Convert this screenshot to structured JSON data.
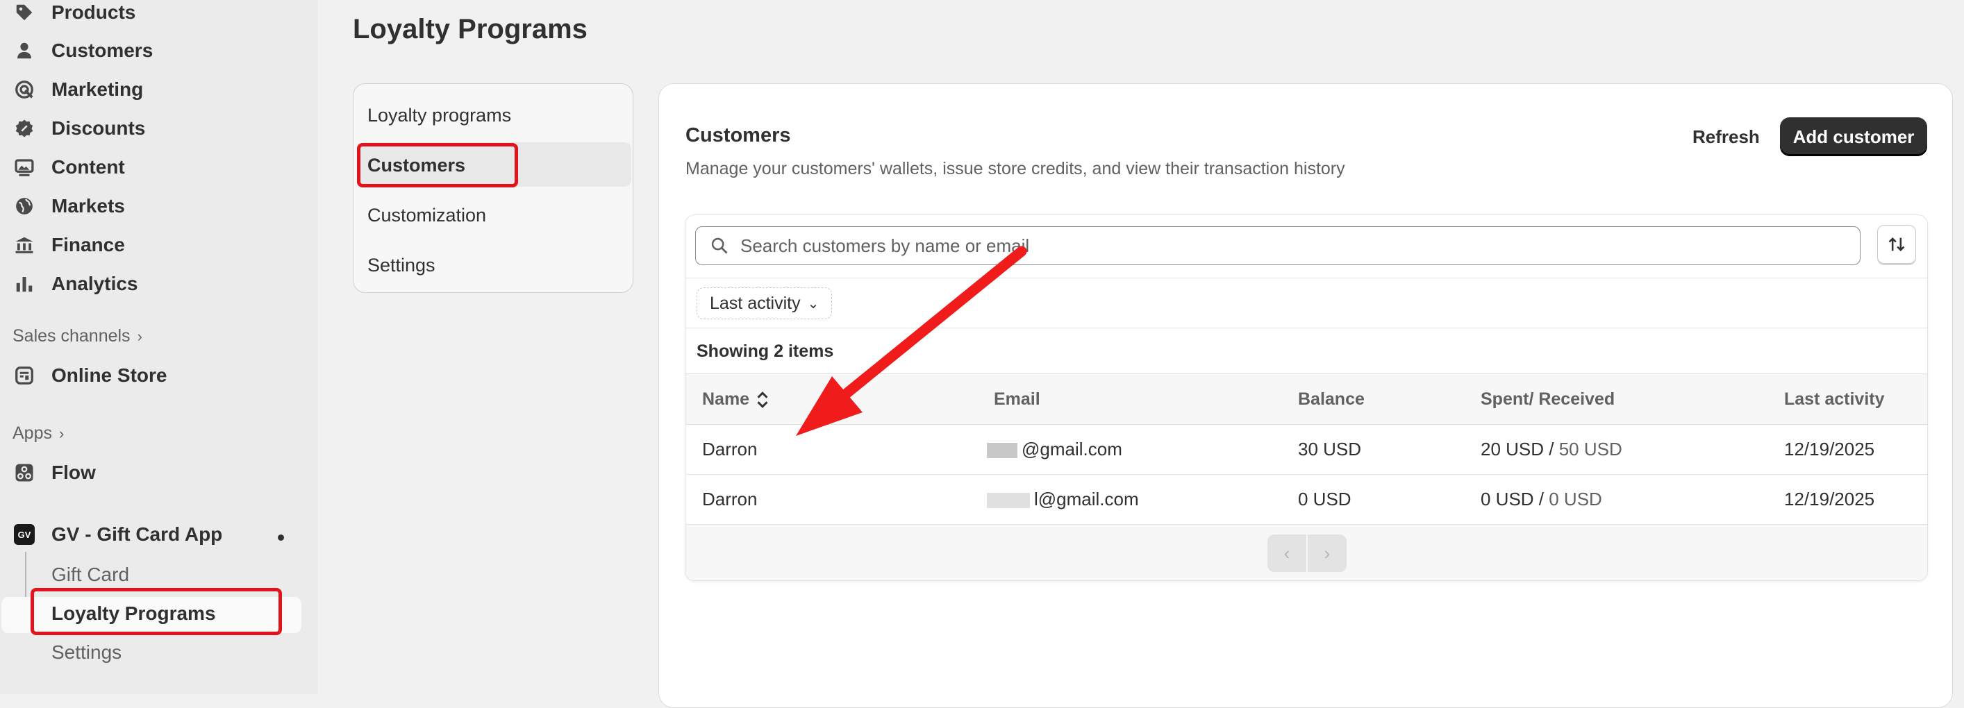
{
  "sidebar": {
    "nav": [
      {
        "label": "Products",
        "icon": "tag-icon"
      },
      {
        "label": "Customers",
        "icon": "person-icon"
      },
      {
        "label": "Marketing",
        "icon": "target-icon"
      },
      {
        "label": "Discounts",
        "icon": "discount-icon"
      },
      {
        "label": "Content",
        "icon": "image-icon"
      },
      {
        "label": "Markets",
        "icon": "globe-icon"
      },
      {
        "label": "Finance",
        "icon": "bank-icon"
      },
      {
        "label": "Analytics",
        "icon": "bar-chart-icon"
      }
    ],
    "sales_channels_label": "Sales channels",
    "online_store_label": "Online Store",
    "apps_label": "Apps",
    "flow_label": "Flow",
    "app_name": "GV - Gift Card App",
    "app_logo_text": "GV",
    "app_sub_items": [
      "Gift Card",
      "Loyalty Programs",
      "Settings"
    ]
  },
  "page_title": "Loyalty Programs",
  "subnav": {
    "items": [
      "Loyalty programs",
      "Customers",
      "Customization",
      "Settings"
    ],
    "active": "Customers"
  },
  "customers_card": {
    "title": "Customers",
    "description": "Manage your customers' wallets, issue store credits, and view their transaction history",
    "refresh_label": "Refresh",
    "add_label": "Add customer",
    "search_placeholder": "Search customers by name or email",
    "filter_label": "Last activity",
    "showing_text": "Showing 2 items",
    "columns": [
      "Name",
      "Email",
      "Balance",
      "Spent/ Received",
      "Last activity"
    ],
    "rows": [
      {
        "name": "Darron",
        "email": "@gmail.com",
        "balance": "30 USD",
        "spent": "20 USD",
        "received": "50 USD",
        "last_activity": "12/19/2025"
      },
      {
        "name": "Darron",
        "email": "l@gmail.com",
        "balance": "0 USD",
        "spent": "0 USD",
        "received": "0 USD",
        "last_activity": "12/19/2025"
      }
    ]
  },
  "colors": {
    "annotation_red": "#e0141c",
    "primary_button": "#303030"
  }
}
